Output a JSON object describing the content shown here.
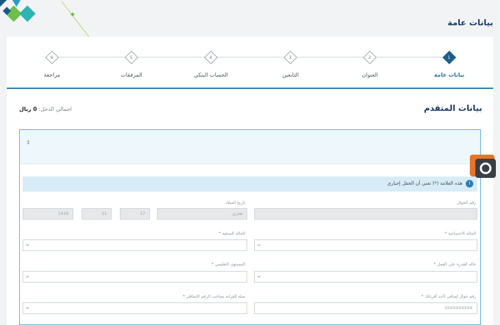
{
  "page": {
    "title": "بيانات عامة"
  },
  "stepper": {
    "steps": [
      {
        "number": "1",
        "label": "بيانات عامة",
        "active": true
      },
      {
        "number": "2",
        "label": "العنوان",
        "active": false
      },
      {
        "number": "3",
        "label": "التابعين",
        "active": false
      },
      {
        "number": "4",
        "label": "الحساب البنكي",
        "active": false
      },
      {
        "number": "5",
        "label": "المرفقات",
        "active": false
      },
      {
        "number": "6",
        "label": "مراجعة",
        "active": false
      }
    ]
  },
  "section": {
    "title": "بيانات المتقدم",
    "income_label": "اجمالي الدخل:",
    "income_value": "0 ريال"
  },
  "form": {
    "head_mark": "‡",
    "notice": "هذه العلامة (*) تعني أن الحقل إجباري",
    "mobile_label": "رقم الجوال",
    "mobile_value": "",
    "dob_label": "تاريخ الميلاد",
    "dob_calendar": "هجري",
    "dob_day": "17",
    "dob_month": "11",
    "dob_year": "1419",
    "social_status_label": "الحالة الاجتماعية *",
    "health_status_label": "الحالة الصحية *",
    "work_ability_label": "حالة القدرة على العمل *",
    "education_label": "المستوى التعليمي *",
    "extra_mobile_label": "رقم جوال إضافي لأحد أقربائك *",
    "extra_mobile_placeholder": "05XXXXXXXX",
    "relation_label": "صلة القرابة بصاحب الرقم الإضافي *"
  },
  "icons": {
    "dropdown": "chevron-down-icon",
    "info": "info-icon"
  },
  "colors": {
    "primary": "#1f5d8a",
    "accent": "#2a7fa8",
    "notice_bg": "#d7ecf6"
  }
}
